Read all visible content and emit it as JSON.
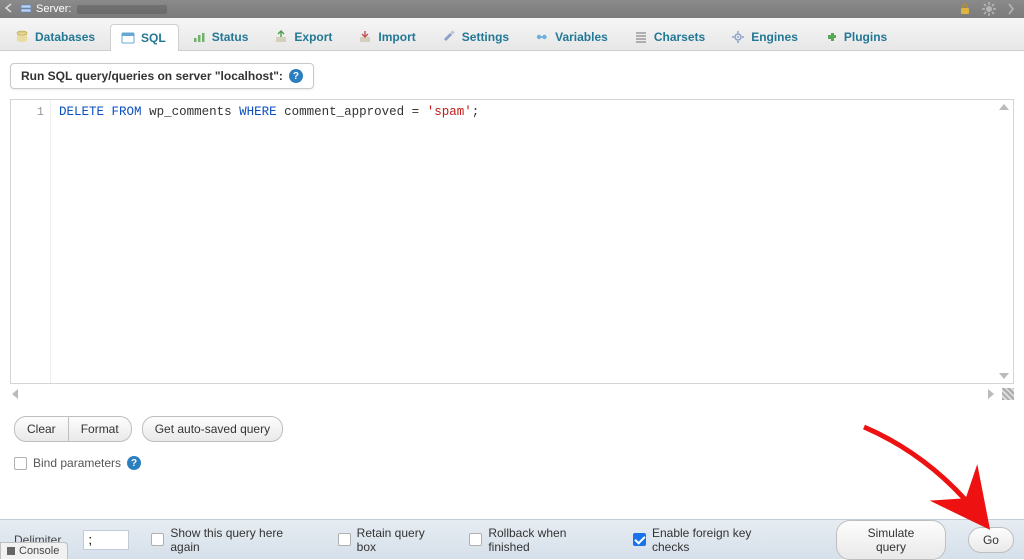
{
  "titlebar": {
    "label": "Server:"
  },
  "tabs": [
    {
      "label": "Databases",
      "icon": "databases-icon"
    },
    {
      "label": "SQL",
      "icon": "sql-icon",
      "active": true
    },
    {
      "label": "Status",
      "icon": "status-icon"
    },
    {
      "label": "Export",
      "icon": "export-icon"
    },
    {
      "label": "Import",
      "icon": "import-icon"
    },
    {
      "label": "Settings",
      "icon": "settings-icon"
    },
    {
      "label": "Variables",
      "icon": "variables-icon"
    },
    {
      "label": "Charsets",
      "icon": "charsets-icon"
    },
    {
      "label": "Engines",
      "icon": "engines-icon"
    },
    {
      "label": "Plugins",
      "icon": "plugins-icon"
    }
  ],
  "query_box": {
    "heading": "Run SQL query/queries on server \"localhost\":",
    "line_number": "1",
    "tokens": {
      "kw1": "DELETE",
      "kw2": "FROM",
      "tbl": "wp_comments",
      "kw3": "WHERE",
      "col": "comment_approved",
      "eq": "=",
      "val": "'spam'",
      "semi": ";"
    }
  },
  "buttons": {
    "clear": "Clear",
    "format": "Format",
    "get_autosaved": "Get auto-saved query"
  },
  "options": {
    "bind_params": "Bind parameters"
  },
  "footer": {
    "delimiter_label": "Delimiter",
    "delimiter_value": ";",
    "show_again": "Show this query here again",
    "retain": "Retain query box",
    "rollback": "Rollback when finished",
    "fk_checks": "Enable foreign key checks",
    "simulate": "Simulate query",
    "go": "Go"
  },
  "console": {
    "label": "Console"
  }
}
